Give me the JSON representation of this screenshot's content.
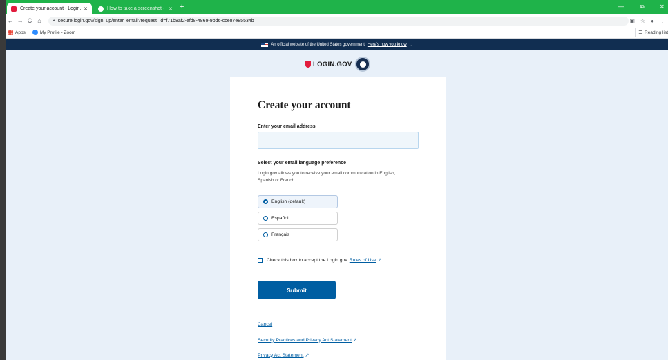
{
  "browser": {
    "tabs": [
      {
        "title": "Create your account - Login.gov",
        "close": "✕",
        "active": true
      },
      {
        "title": "How to take a screenshot - Goo...",
        "close": "✕",
        "active": false
      }
    ],
    "new_tab": "+",
    "window_controls": {
      "minimize": "—",
      "restore": "⧉",
      "close": "✕"
    },
    "nav": {
      "back": "←",
      "forward": "→",
      "reload": "C",
      "home": "⌂"
    },
    "url": "secure.login.gov/sign_up/enter_email?request_id=f71b8af2-efd8-4869-9bd6-cce87e85534b",
    "bookmarks": [
      {
        "label": "Apps",
        "icon": "apps-grid-icon"
      },
      {
        "label": "My Profile - Zoom",
        "icon": "zoom-icon"
      }
    ],
    "reading_list": "Reading list"
  },
  "gov_banner": {
    "text": "An official website of the United States government",
    "link": "Here's how you know",
    "chevron": "⌄"
  },
  "logo": {
    "text": "LOGIN.GOV"
  },
  "form": {
    "title": "Create your account",
    "email_label": "Enter your email address",
    "email_value": "",
    "lang_heading": "Select your email language preference",
    "lang_desc": "Login.gov allows you to receive your email communication in English, Spanish or French.",
    "languages": [
      {
        "label": "English (default)",
        "selected": true
      },
      {
        "label": "Español",
        "selected": false
      },
      {
        "label": "Français",
        "selected": false
      }
    ],
    "rules_prefix": "Check this box to accept the Login.gov",
    "rules_link": "Rules of Use",
    "submit": "Submit"
  },
  "footer_links": [
    {
      "label": "Cancel",
      "external": false
    },
    {
      "label": "Security Practices and Privacy Act Statement",
      "external": true
    },
    {
      "label": "Privacy Act Statement",
      "external": true
    }
  ],
  "colors": {
    "primary": "#005ea2",
    "banner": "#112e51",
    "tabbar": "#1fb34a",
    "page_bg": "#e8f0f9"
  }
}
